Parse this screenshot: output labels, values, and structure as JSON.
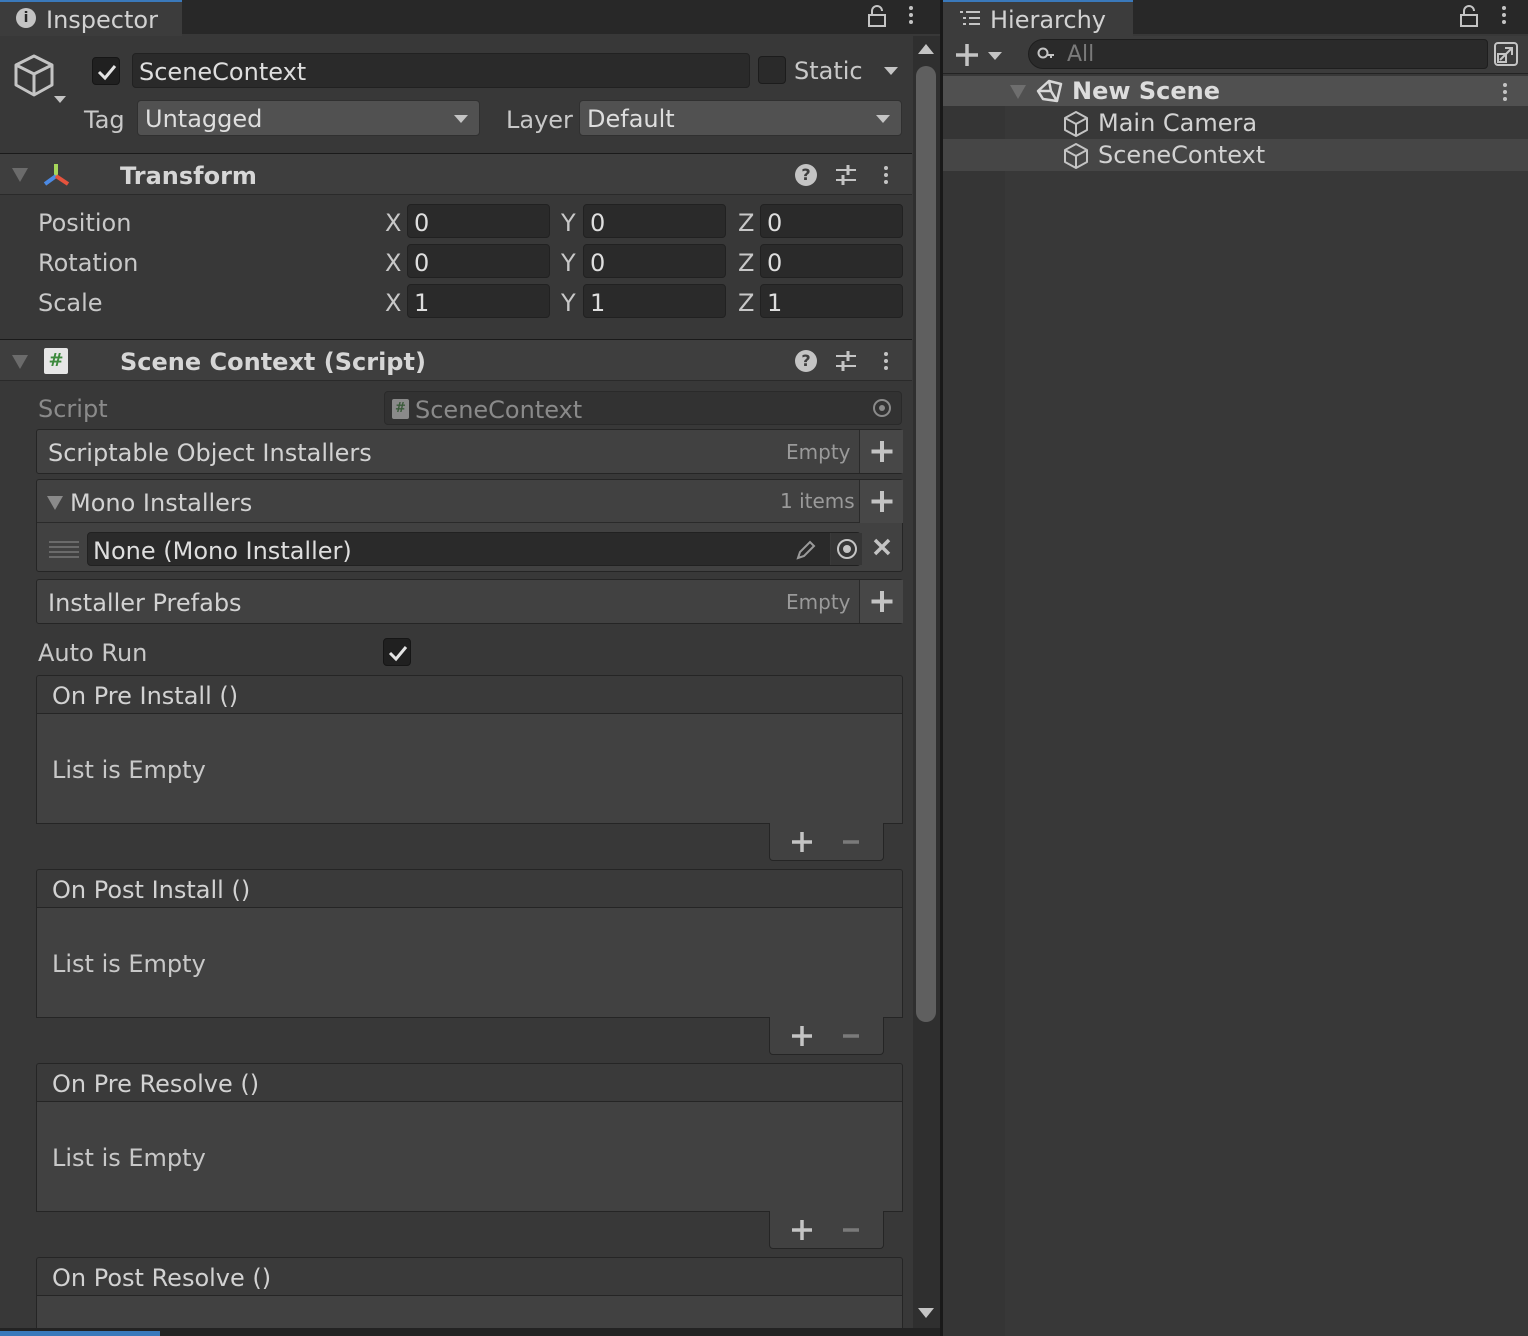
{
  "inspector": {
    "tab_title": "Inspector",
    "object": {
      "active": true,
      "name": "SceneContext",
      "static_label": "Static",
      "static_checked": false,
      "tag_label": "Tag",
      "tag_value": "Untagged",
      "layer_label": "Layer",
      "layer_value": "Default"
    },
    "transform": {
      "title": "Transform",
      "rows": [
        {
          "label": "Position",
          "x": "0",
          "y": "0",
          "z": "0"
        },
        {
          "label": "Rotation",
          "x": "0",
          "y": "0",
          "z": "0"
        },
        {
          "label": "Scale",
          "x": "1",
          "y": "1",
          "z": "1"
        }
      ],
      "axis_x": "X",
      "axis_y": "Y",
      "axis_z": "Z"
    },
    "scene_context": {
      "title": "Scene Context (Script)",
      "script_label": "Script",
      "script_value": "SceneContext",
      "scriptable_installers": {
        "label": "Scriptable Object Installers",
        "count": "Empty"
      },
      "mono_installers": {
        "label": "Mono Installers",
        "count": "1 items",
        "item": "None (Mono Installer)"
      },
      "installer_prefabs": {
        "label": "Installer Prefabs",
        "count": "Empty"
      },
      "auto_run_label": "Auto Run",
      "auto_run_checked": true,
      "events": [
        {
          "title": "On Pre Install ()",
          "empty_text": "List is Empty"
        },
        {
          "title": "On Post Install ()",
          "empty_text": "List is Empty"
        },
        {
          "title": "On Pre Resolve ()",
          "empty_text": "List is Empty"
        },
        {
          "title": "On Post Resolve ()",
          "empty_text": ""
        }
      ]
    }
  },
  "hierarchy": {
    "tab_title": "Hierarchy",
    "search_placeholder": "All",
    "scene_name": "New Scene",
    "items": [
      "Main Camera",
      "SceneContext"
    ]
  },
  "colors": {
    "panel_bg": "#383838",
    "header_bg": "#3e3e3e",
    "field_bg": "#2a2a2a",
    "selection_bg": "#464646",
    "text": "#c8c8c8"
  },
  "icons": {
    "info": "info-icon",
    "lock": "lock-icon",
    "kebab": "more-vert-icon",
    "cube": "cube-icon",
    "help": "help-icon",
    "presets": "sliders-icon",
    "script": "script-hash-icon",
    "unity": "unity-scene-icon"
  }
}
